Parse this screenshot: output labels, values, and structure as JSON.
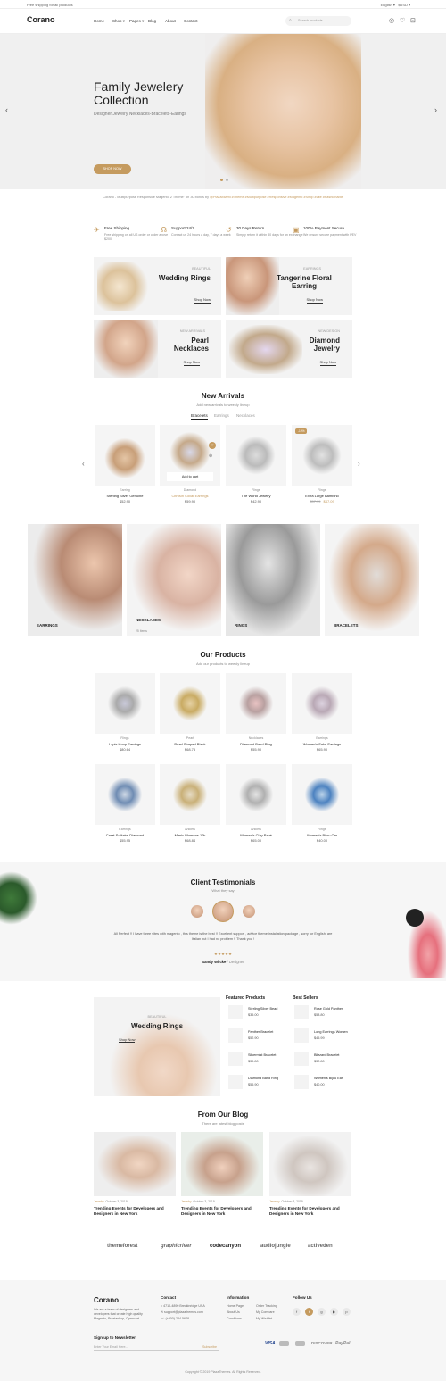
{
  "topbar": {
    "shipping": "Free shipping for all products",
    "lang": "English",
    "currency": "$USD"
  },
  "header": {
    "logo": "Corano",
    "nav": [
      "Home",
      "Shop",
      "Pages",
      "Blog",
      "About",
      "Contact"
    ],
    "search_placeholder": "Search products..."
  },
  "hero": {
    "title": "Family Jewelery Collection",
    "subtitle": "Designer Jewelry Necklaces-Bracelets-Earings",
    "cta": "SHOP NOW"
  },
  "tagline": {
    "text": "Corano - Multipurpose Responsive Magento 2 Theme\" on 30 bonds by",
    "highlight": "@PlazaMiami #Theme #Multipurpose #Responsive #Magento #Shop #Lite #Fashionable"
  },
  "features": [
    {
      "title": "Free Shipping",
      "desc": "Free shipping on all US order or order above $200"
    },
    {
      "title": "Support 24/7",
      "desc": "Contact us 24 hours a day, 7 days a week"
    },
    {
      "title": "30 Days Return",
      "desc": "Simply return it within 30 days for an exchange"
    },
    {
      "title": "100% Payment Secure",
      "desc": "We ensure secure payment with PEV"
    }
  ],
  "banners": [
    {
      "tag": "BEAUTIFUL",
      "title": "Wedding Rings",
      "link": "Shop Now"
    },
    {
      "tag": "EARRINGS",
      "title": "Tangerine Floral Earring",
      "link": "Shop Now"
    },
    {
      "tag": "NEW ARRIVALS",
      "title": "Pearl Necklaces",
      "link": "Shop Now"
    },
    {
      "tag": "NEW DESIGN",
      "title": "Diamond Jewelry",
      "link": "Shop Now"
    }
  ],
  "new_arrivals": {
    "title": "New Arrivals",
    "subtitle": "Add new arrivals to weekly lineup",
    "tabs": [
      "Bracelets",
      "Earrings",
      "Necklaces"
    ],
    "add_to_cart": "Add to cart",
    "sale": "-10%",
    "items": [
      {
        "cat": "Earring",
        "name": "Sterling Silver Genuine",
        "price": "$52.90"
      },
      {
        "cat": "Diamond",
        "name": "Citrusin Collar Earrings",
        "price": "$59.90"
      },
      {
        "cat": "Rings",
        "name": "The World Jewelry",
        "price": "$42.90"
      },
      {
        "cat": "Rings",
        "name": "Extra Large Bambino",
        "old": "$57.99",
        "price": "$47.09"
      }
    ]
  },
  "categories": [
    {
      "name": "EARRINGS",
      "count": ""
    },
    {
      "name": "NECKLACES",
      "count": "25 Items"
    },
    {
      "name": "RINGS",
      "count": ""
    },
    {
      "name": "BRACELETS",
      "count": ""
    }
  ],
  "our_products": {
    "title": "Our Products",
    "subtitle": "Add our products to weekly lineup",
    "items": [
      {
        "cat": "Rings",
        "name": "Lapis Hoop Earrings",
        "price": "$80.64"
      },
      {
        "cat": "Pearl",
        "name": "Pearl Shaped Black",
        "price": "$68.75"
      },
      {
        "cat": "Necklaces",
        "name": "Diamond Band Ring",
        "price": "$55.90"
      },
      {
        "cat": "Earrings",
        "name": "Women's Fake Earrings",
        "price": "$65.90"
      },
      {
        "cat": "Earrings",
        "name": "Carat Solitaire Diamond",
        "price": "$55.95"
      },
      {
        "cat": "Anklets",
        "name": "Mimic Womens 10k",
        "price": "$68.84"
      },
      {
        "cat": "Anklets",
        "name": "Women's Clay Pavé",
        "price": "$65.00"
      },
      {
        "cat": "Rings",
        "name": "Women's Bijou Car",
        "price": "$40.00"
      }
    ]
  },
  "testimonials": {
    "title": "Client Testimonials",
    "subtitle": "What they say",
    "quote": "All Perfect !! I have three sites with magento , this theme is the best !! Excellent support , advice theme installation package , sorry for English, are Italian but I had no problem !! Thank you !",
    "stars": "★★★★★",
    "author": "Sandy Wilcke",
    "role": "/ Designer"
  },
  "promo": {
    "tag": "BEAUTIFUL",
    "title": "Wedding Rings",
    "link": "Shop Now"
  },
  "featured": {
    "title": "Featured Products",
    "items": [
      {
        "name": "Sterling Silver Bead",
        "price": "$35.00"
      },
      {
        "name": "Panther Bracelet",
        "price": "$52.90"
      },
      {
        "name": "Silvermist Bracelet",
        "price": "$39.80"
      },
      {
        "name": "Diamond Band Ring",
        "price": "$55.90"
      }
    ]
  },
  "bestsellers": {
    "title": "Best Sellers",
    "items": [
      {
        "name": "Rose Gold Panther",
        "price": "$58.80"
      },
      {
        "name": "Long Earrings Women",
        "price": "$45.99"
      },
      {
        "name": "Blizzard Bracelet",
        "price": "$32.80"
      },
      {
        "name": "Women's Bijou Ear",
        "price": "$40.00"
      }
    ]
  },
  "blog": {
    "title": "From Our Blog",
    "subtitle": "There are latest blog posts",
    "posts": [
      {
        "cat": "Jewelry",
        "date": "October 3, 2019",
        "title": "Trending Events for Developers and Designers in New York"
      },
      {
        "cat": "Jewelry",
        "date": "October 3, 2019",
        "title": "Trending Events for Developers and Designers in New York"
      },
      {
        "cat": "Jewelry",
        "date": "October 3, 2019",
        "title": "Trending Events for Developers and Designers in New York"
      }
    ]
  },
  "brands": [
    "themeforest",
    "graphicriver",
    "codecanyon",
    "audiojungle",
    "activeden"
  ],
  "footer": {
    "about": "We are a team of designers and developers that create high quality Magento, Prestashop, Opencart.",
    "contact_title": "Contact",
    "contact": [
      "4710-4890 Breckinridge USA",
      "support@plazathemes.com",
      "(+800) 234 5678"
    ],
    "info_title": "Information",
    "info_col1": [
      "Home Page",
      "About Us",
      "Conditions"
    ],
    "info_col2": [
      "Order Tracking",
      "My Compare",
      "My Wishlist"
    ],
    "follow": "Follow Us",
    "newsletter": "Sign up to Newsletter",
    "email_ph": "Enter Your Email Here...",
    "subscribe": "Subscribe",
    "payments": [
      "VISA",
      "",
      "",
      "DISCOVER",
      "PayPal"
    ],
    "copyright": "Copyright © 2019 PlazaThemes. All Rights Reserved."
  },
  "colors": {
    "accent": "#c59b5f"
  }
}
